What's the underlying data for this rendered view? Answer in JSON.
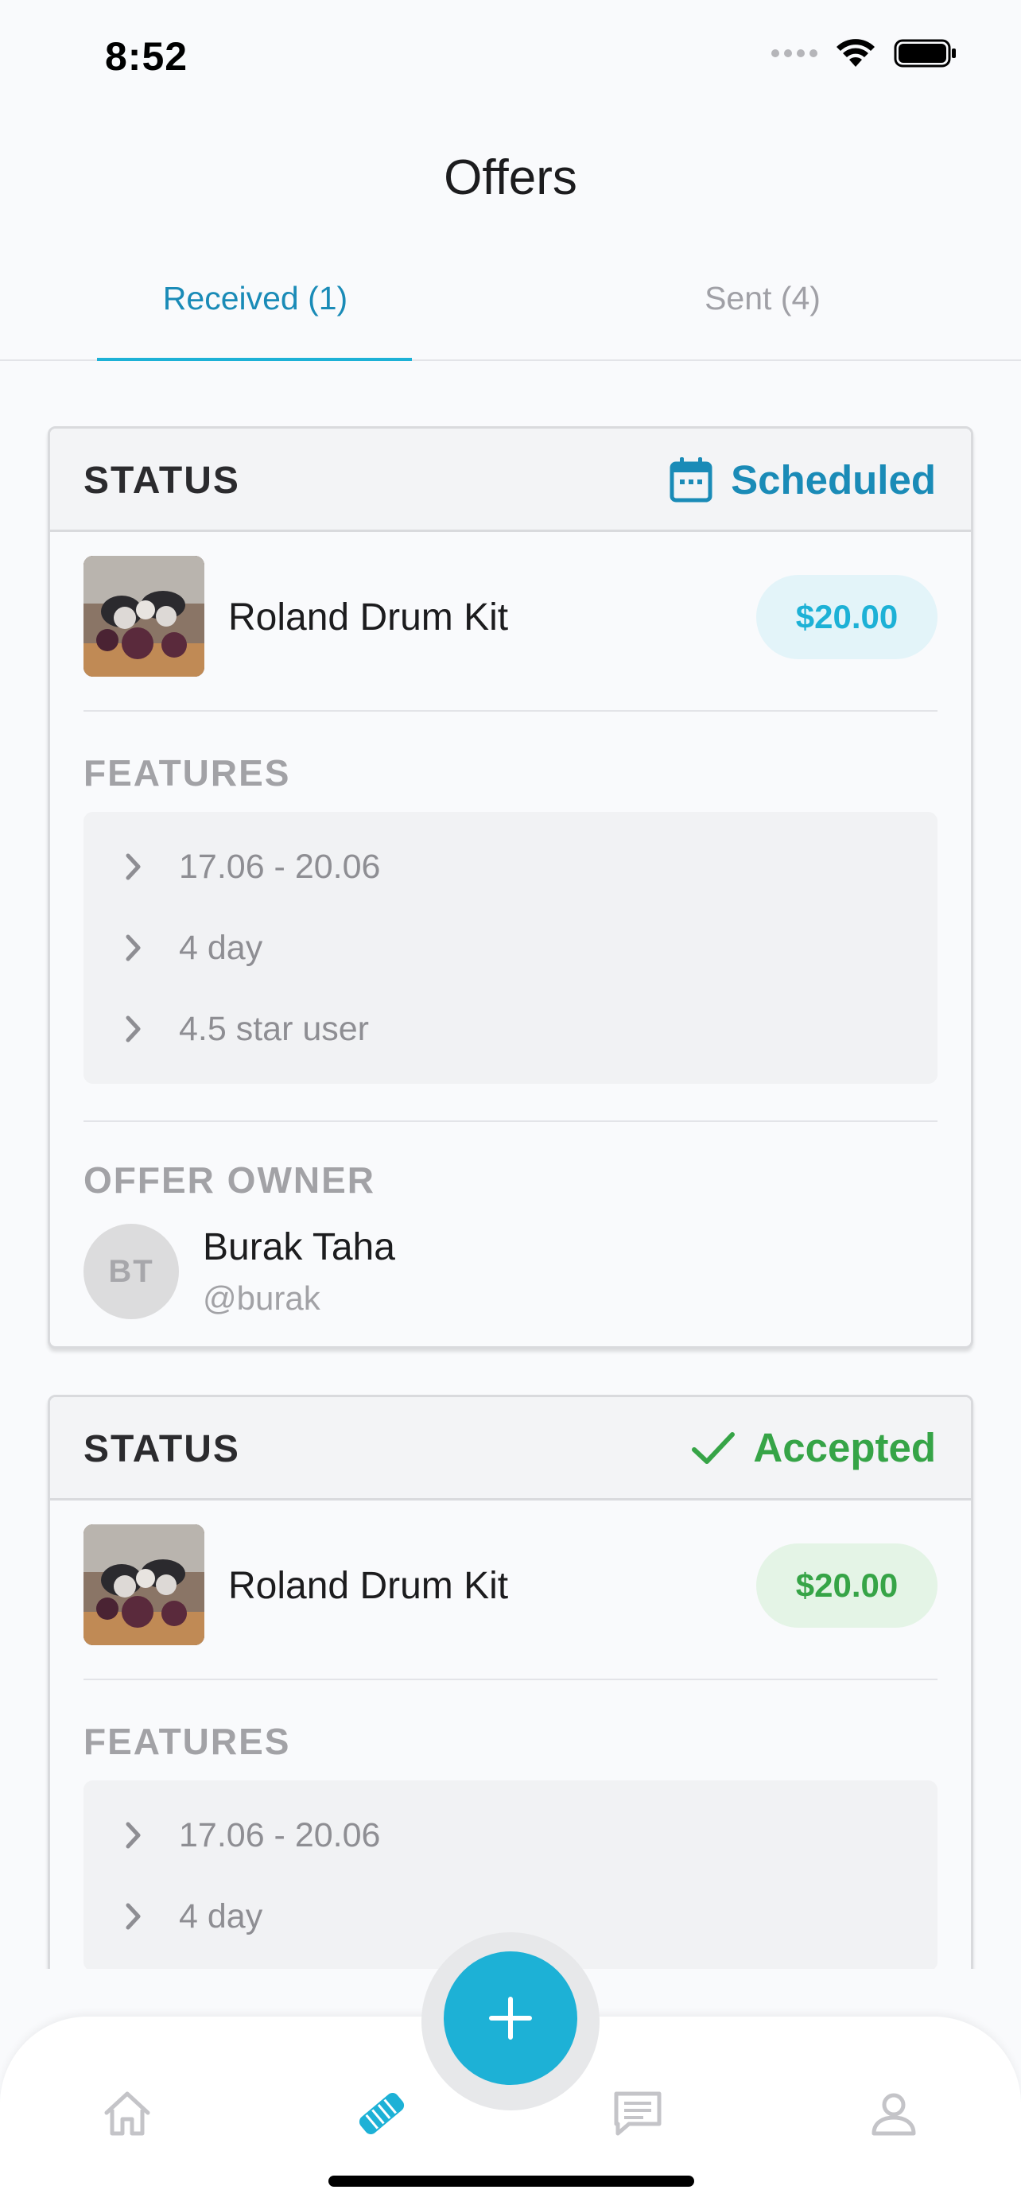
{
  "status_bar": {
    "time": "8:52"
  },
  "header": {
    "title": "Offers"
  },
  "tabs": [
    {
      "label": "Received (1)",
      "active": true
    },
    {
      "label": "Sent (4)",
      "active": false
    }
  ],
  "offers": [
    {
      "status_label": "STATUS",
      "status": "Scheduled",
      "status_icon": "calendar-icon",
      "status_color": "#1a8bb7",
      "item_name": "Roland Drum Kit",
      "price": "$20.00",
      "price_color": "#1db1d6",
      "features_label": "FEATURES",
      "features": [
        "17.06 - 20.06",
        "4 day",
        "4.5 star user"
      ],
      "owner_label": "OFFER OWNER",
      "owner": {
        "initials": "BT",
        "name": "Burak Taha",
        "handle": "@burak"
      }
    },
    {
      "status_label": "STATUS",
      "status": "Accepted",
      "status_icon": "check-icon",
      "status_color": "#36a447",
      "item_name": "Roland Drum Kit",
      "price": "$20.00",
      "price_color": "#36a447",
      "features_label": "FEATURES",
      "features": [
        "17.06 - 20.06",
        "4 day"
      ]
    }
  ],
  "bottom_nav": {
    "items": [
      "home-icon",
      "handshake-icon",
      "chat-icon",
      "profile-icon"
    ],
    "active": "handshake-icon",
    "fab_icon": "plus-icon",
    "accent": "#1db1d6"
  }
}
